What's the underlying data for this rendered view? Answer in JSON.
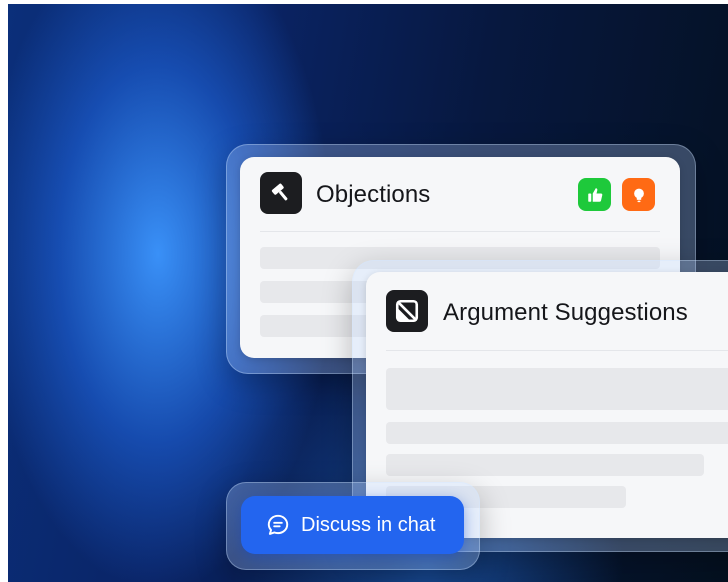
{
  "objections_card": {
    "title": "Objections",
    "icon": "gavel-icon",
    "badges": [
      {
        "icon": "thumbs-up-icon",
        "color": "#1ec93b"
      },
      {
        "icon": "lightbulb-icon",
        "color": "#ff6a14"
      }
    ]
  },
  "suggestions_card": {
    "title": "Argument Suggestions",
    "icon": "slash-square-icon"
  },
  "chat_button": {
    "label": "Discuss in chat",
    "icon": "chat-bubble-icon",
    "color": "#2365ef"
  }
}
